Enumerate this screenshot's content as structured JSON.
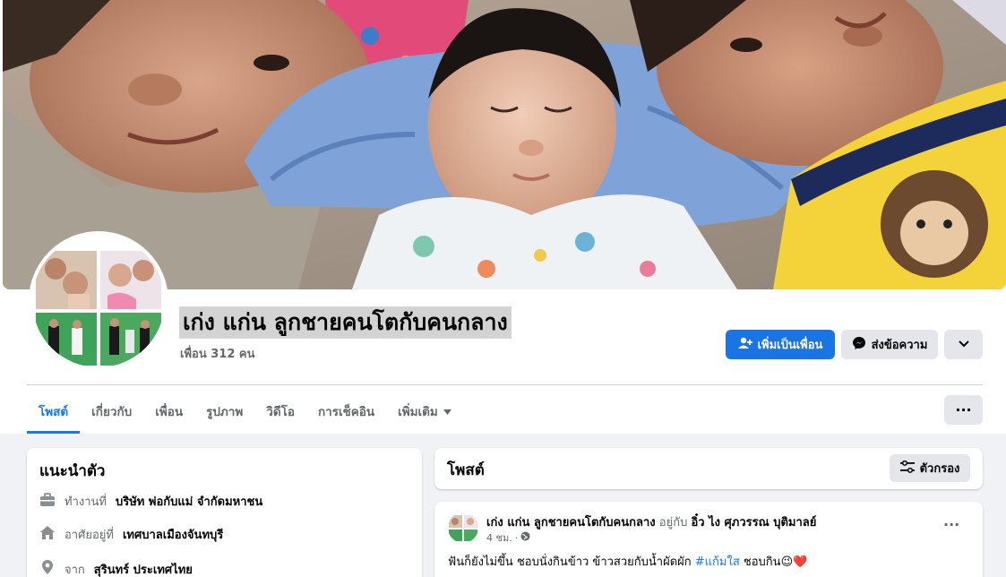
{
  "profile": {
    "name": "เก่ง แก่น ลูกชายคนโตกับคนกลาง",
    "friends": "เพื่อน 312 คน"
  },
  "actions": {
    "add_friend": "เพิ่มเป็นเพื่อน",
    "message": "ส่งข้อความ",
    "dropdown_icon": "chevron-down-icon"
  },
  "tabs": [
    {
      "label": "โพสต์"
    },
    {
      "label": "เกี่ยวกับ"
    },
    {
      "label": "เพื่อน"
    },
    {
      "label": "รูปภาพ"
    },
    {
      "label": "วิดีโอ"
    },
    {
      "label": "การเช็คอิน"
    },
    {
      "label": "เพิ่มเติม"
    }
  ],
  "more_label": "···",
  "intro": {
    "title": "แนะนำตัว",
    "work_prefix": "ทำงานที่",
    "work_value": "บริษัท พ่อกับแม่ จำกัดมหาชน",
    "lives_prefix": "อาศัยอยู่ที่",
    "lives_value": "เทศบาลเมืองจันทบุรี",
    "from_prefix": "จาก",
    "from_value": "สุรินทร์ ประเทศไทย"
  },
  "posts": {
    "title": "โพสต์",
    "filter": "ตัวกรอง"
  },
  "post": {
    "author": "เก่ง แก่น ลูกชายคนโตกับคนกลาง",
    "with_word": "อยู่กับ",
    "tagged": "อิ๋ว ไง ศุภวรรณ บุติมาลย์",
    "time": "4 ชม.",
    "dot": "·",
    "text_before": "ฟันก็ยังไม่ขึ้น ชอบนั่งกินข้าว ข้าวสวยกับน้ำผัดผัก",
    "hashtag": "#แก้มใส",
    "text_after": "  ชอบกิน😉❤️"
  },
  "colors": {
    "primary": "#1b74e4",
    "link": "#1877f2",
    "secondary_bg": "#e4e6eb",
    "muted": "#65676b"
  }
}
